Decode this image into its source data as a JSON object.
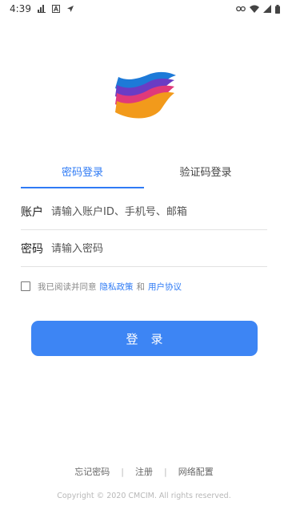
{
  "status_bar": {
    "time": "4:39",
    "icons": [
      "signal-bars-icon",
      "notification-a-icon",
      "location-arrow-icon",
      "link-icon",
      "wifi-icon",
      "cell-signal-icon",
      "battery-icon"
    ]
  },
  "logo": {
    "name": "app-logo",
    "colors": [
      "#1d6fd6",
      "#6a3cc4",
      "#e0397a",
      "#f29a1b"
    ]
  },
  "tabs": [
    {
      "label": "密码登录",
      "active": true
    },
    {
      "label": "验证码登录",
      "active": false
    }
  ],
  "form": {
    "account": {
      "label": "账户",
      "placeholder": "请输入账户ID、手机号、邮箱",
      "value": ""
    },
    "password": {
      "label": "密码",
      "placeholder": "请输入密码",
      "value": ""
    }
  },
  "agreement": {
    "checked": false,
    "prefix": "我已阅读并同意",
    "privacy_link": "隐私政策",
    "and": "和",
    "user_link": "用户协议"
  },
  "login_button": {
    "label": "登录"
  },
  "footer": {
    "forgot_password": "忘记密码",
    "register": "注册",
    "network_config": "网络配置",
    "separator": "|",
    "copyright": "Copyright © 2020 CMCIM. All rights reserved."
  },
  "colors": {
    "accent": "#2f7bf5",
    "button": "#3d85f4",
    "divider": "#e2e2e2"
  }
}
